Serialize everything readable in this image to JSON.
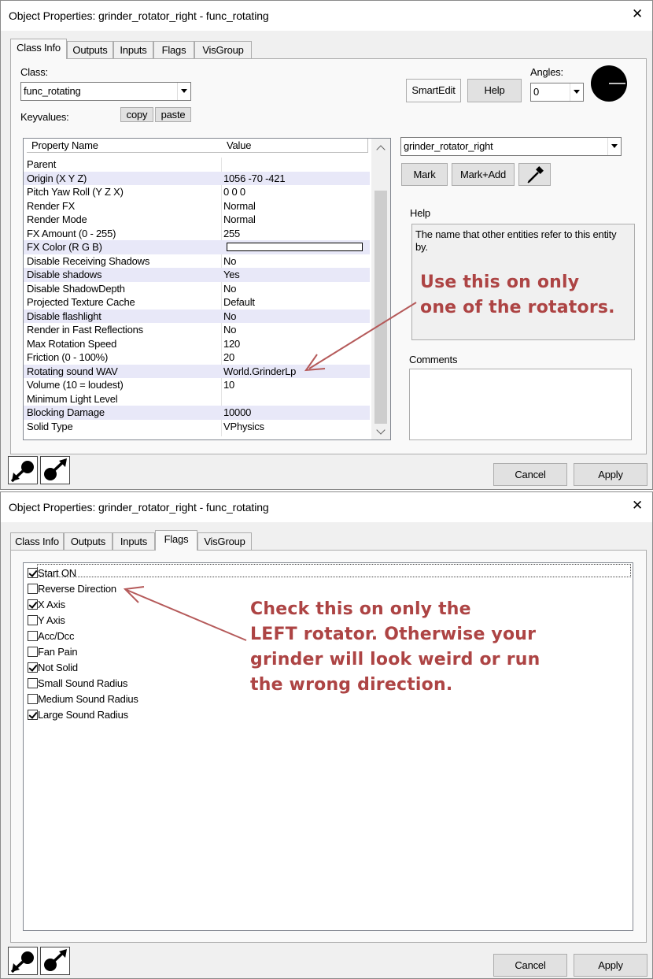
{
  "window1": {
    "title": "Object Properties: grinder_rotator_right - func_rotating",
    "close_glyph": "✕",
    "tabs": [
      "Class Info",
      "Outputs",
      "Inputs",
      "Flags",
      "VisGroup"
    ],
    "class_label": "Class:",
    "class_value": "func_rotating",
    "keyvalues_label": "Keyvalues:",
    "copy_label": "copy",
    "paste_label": "paste",
    "smartedit_label": "SmartEdit",
    "help_button_label": "Help",
    "angles_label": "Angles:",
    "angles_value": "0",
    "grid_headers": [
      "Property Name",
      "Value"
    ],
    "properties": [
      {
        "name": "Parent",
        "value": ""
      },
      {
        "name": "Origin (X Y Z)",
        "value": "1056 -70 -421"
      },
      {
        "name": "Pitch Yaw Roll (Y Z X)",
        "value": "0 0 0"
      },
      {
        "name": "Render FX",
        "value": "Normal"
      },
      {
        "name": "Render Mode",
        "value": "Normal"
      },
      {
        "name": "FX Amount (0 - 255)",
        "value": "255"
      },
      {
        "name": "FX Color (R G B)",
        "value": ""
      },
      {
        "name": "Disable Receiving Shadows",
        "value": "No"
      },
      {
        "name": "Disable shadows",
        "value": "Yes"
      },
      {
        "name": "Disable ShadowDepth",
        "value": "No"
      },
      {
        "name": "Projected Texture Cache",
        "value": "Default"
      },
      {
        "name": "Disable flashlight",
        "value": "No"
      },
      {
        "name": "Render in Fast Reflections",
        "value": "No"
      },
      {
        "name": "Max Rotation Speed",
        "value": "120"
      },
      {
        "name": "Friction (0 - 100%)",
        "value": "20"
      },
      {
        "name": "Rotating sound WAV",
        "value": "World.GrinderLp"
      },
      {
        "name": "Volume (10 = loudest)",
        "value": "10"
      },
      {
        "name": "Minimum Light Level",
        "value": ""
      },
      {
        "name": "Blocking Damage",
        "value": "10000"
      },
      {
        "name": "Solid Type",
        "value": "VPhysics"
      }
    ],
    "name_combo_value": "grinder_rotator_right",
    "mark_label": "Mark",
    "mark_add_label": "Mark+Add",
    "help_section_label": "Help",
    "help_text": "The name that other entities refer to this entity by.",
    "comments_label": "Comments",
    "annotation_lines": [
      "Use this on only",
      "one of the rotators."
    ],
    "cancel_label": "Cancel",
    "apply_label": "Apply"
  },
  "window2": {
    "title": "Object Properties: grinder_rotator_right - func_rotating",
    "close_glyph": "✕",
    "tabs": [
      "Class Info",
      "Outputs",
      "Inputs",
      "Flags",
      "VisGroup"
    ],
    "flags": [
      {
        "label": "Start ON",
        "checked": true
      },
      {
        "label": "Reverse Direction",
        "checked": false
      },
      {
        "label": "X Axis",
        "checked": true
      },
      {
        "label": "Y Axis",
        "checked": false
      },
      {
        "label": "Acc/Dcc",
        "checked": false
      },
      {
        "label": "Fan Pain",
        "checked": false
      },
      {
        "label": "Not Solid",
        "checked": true
      },
      {
        "label": "Small Sound Radius",
        "checked": false
      },
      {
        "label": "Medium Sound Radius",
        "checked": false
      },
      {
        "label": "Large Sound Radius",
        "checked": true
      }
    ],
    "annotation_lines": [
      "Check this on only the",
      "LEFT rotator.  Otherwise your",
      "grinder will look weird or run",
      "the wrong direction."
    ],
    "cancel_label": "Cancel",
    "apply_label": "Apply"
  },
  "colors": {
    "annotation": "#ad4444",
    "grid_alt_row": "#e8e8f8",
    "default_button_border": "#0078d7"
  },
  "icons": [
    "close-icon",
    "chevron-down-icon",
    "angle-dial-icon",
    "eyedropper-icon",
    "arrow-to-point-icon",
    "arrow-from-point-icon",
    "checkbox-icon"
  ]
}
